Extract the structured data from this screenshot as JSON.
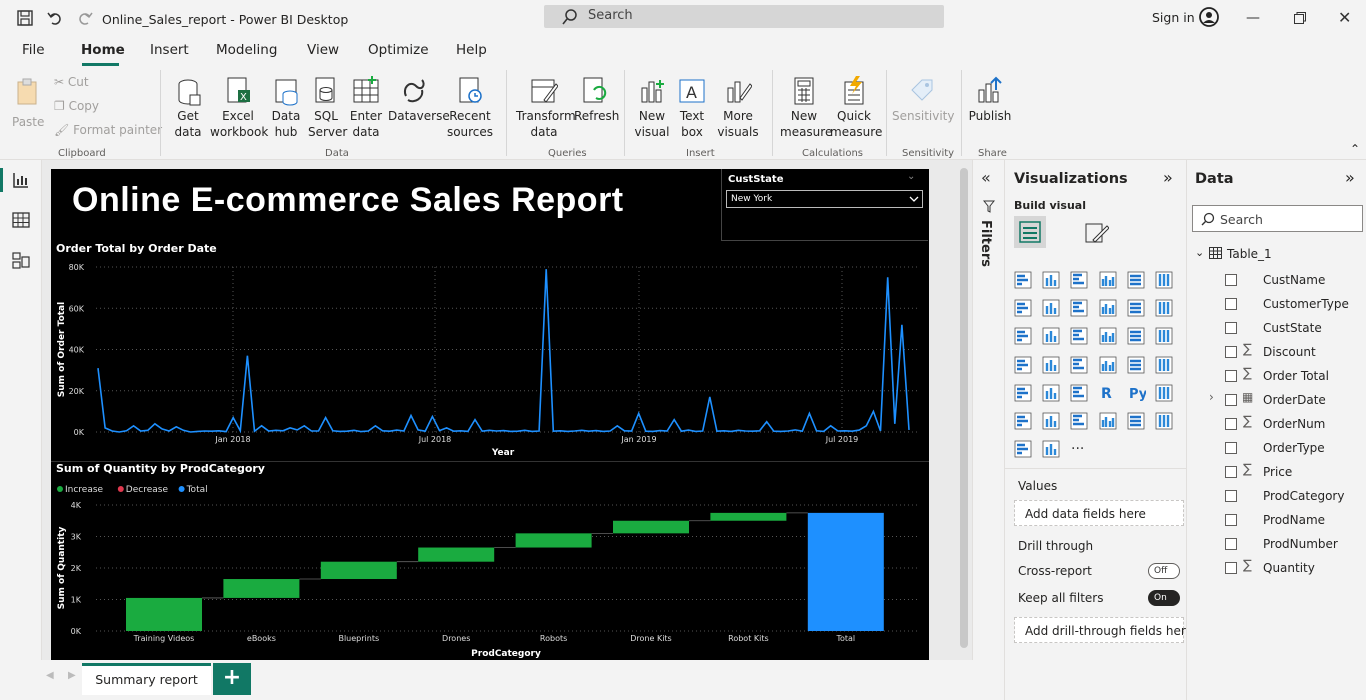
{
  "titlebar": {
    "title": "Online_Sales_report - Power BI Desktop",
    "search": "Search",
    "sign_in": "Sign in"
  },
  "menu": [
    "File",
    "Home",
    "Insert",
    "Modeling",
    "View",
    "Optimize",
    "Help"
  ],
  "ribbon": {
    "clipboard": {
      "paste": "Paste",
      "cut": "Cut",
      "copy": "Copy",
      "format_painter": "Format painter",
      "group": "Clipboard"
    },
    "data": {
      "get_data": "Get data",
      "excel": "Excel workbook",
      "data_hub": "Data hub",
      "sql": "SQL Server",
      "enter_data": "Enter data",
      "dataverse": "Dataverse",
      "recent": "Recent sources",
      "group": "Data"
    },
    "queries": {
      "transform": "Transform data",
      "refresh": "Refresh",
      "group": "Queries"
    },
    "insert": {
      "new_visual": "New visual",
      "text_box": "Text box",
      "more_visuals": "More visuals",
      "group": "Insert"
    },
    "calculations": {
      "new_measure": "New measure",
      "quick_measure": "Quick measure",
      "group": "Calculations"
    },
    "sensitivity": {
      "label": "Sensitivity",
      "group": "Sensitivity"
    },
    "share": {
      "publish": "Publish",
      "group": "Share"
    }
  },
  "report": {
    "title": "Online E-commerce Sales Report",
    "slicer": {
      "label": "CustState",
      "value": "New York"
    }
  },
  "chart_data": [
    {
      "type": "line",
      "title": "Order Total by Order Date",
      "xlabel": "Year",
      "ylabel": "Sum of Order Total",
      "ylim": [
        0,
        80000
      ],
      "yticks": [
        "0K",
        "20K",
        "40K",
        "60K",
        "80K"
      ],
      "xticks": [
        "Jan 2018",
        "Jul 2018",
        "Jan 2019",
        "Jul 2019"
      ],
      "series_color": "#1e90ff",
      "grid": true,
      "series": [
        {
          "values": [
            31000,
            2000,
            500,
            0,
            600,
            3000,
            500,
            800,
            4000,
            1500,
            500,
            2500,
            800,
            0,
            300,
            500,
            400,
            600,
            200,
            7000,
            600,
            37000,
            400,
            3000,
            500,
            800,
            600,
            2000,
            1000,
            3000,
            500,
            500,
            7000,
            600,
            300,
            400,
            800,
            200,
            500,
            3000,
            600,
            400,
            900,
            500,
            8000,
            1000,
            400,
            7500,
            700,
            2000,
            400,
            600,
            300,
            6000,
            400,
            800,
            500,
            700,
            300,
            400,
            800,
            300,
            500,
            79000,
            400,
            600,
            300,
            500,
            800,
            400,
            700,
            300,
            500,
            3000,
            600,
            500,
            9000,
            400,
            300,
            700,
            500,
            6000,
            400,
            900,
            300,
            500,
            17000,
            400,
            600,
            300,
            800,
            500,
            400,
            600,
            5000,
            400,
            300,
            500,
            1000,
            400,
            9000,
            600,
            300,
            3000,
            500,
            600,
            400,
            900,
            3000,
            10000,
            500,
            75000,
            4000,
            52000,
            1000
          ]
        }
      ]
    },
    {
      "type": "waterfall",
      "title": "Sum of Quantity by ProdCategory",
      "xlabel": "ProdCategory",
      "ylabel": "Sum of Quantity",
      "ylim": [
        0,
        4000
      ],
      "yticks": [
        "0K",
        "1K",
        "2K",
        "3K",
        "4K"
      ],
      "legend": [
        {
          "name": "Increase",
          "color": "#1aab40"
        },
        {
          "name": "Decrease",
          "color": "#e0384e"
        },
        {
          "name": "Total",
          "color": "#1e90ff"
        }
      ],
      "categories": [
        "Training Videos",
        "eBooks",
        "Blueprints",
        "Drones",
        "Robots",
        "Drone Kits",
        "Robot Kits",
        "Total"
      ],
      "values": [
        1050,
        600,
        550,
        450,
        450,
        400,
        250,
        3750
      ]
    }
  ],
  "visualizations": {
    "title": "Visualizations",
    "build_visual": "Build visual",
    "values_label": "Values",
    "values_placeholder": "Add data fields here",
    "drill_through": "Drill through",
    "cross_report": "Cross-report",
    "cross_report_state": "Off",
    "keep_filters": "Keep all filters",
    "keep_filters_state": "On",
    "drill_placeholder": "Add drill-through fields here"
  },
  "filters": {
    "label": "Filters"
  },
  "data_pane": {
    "title": "Data",
    "search": "Search",
    "table": "Table_1",
    "fields": [
      {
        "name": "CustName",
        "sigma": false
      },
      {
        "name": "CustomerType",
        "sigma": false
      },
      {
        "name": "CustState",
        "sigma": false
      },
      {
        "name": "Discount",
        "sigma": true
      },
      {
        "name": "Order Total",
        "sigma": true
      },
      {
        "name": "OrderDate",
        "sigma": false,
        "date": true
      },
      {
        "name": "OrderNum",
        "sigma": true
      },
      {
        "name": "OrderType",
        "sigma": false
      },
      {
        "name": "Price",
        "sigma": true
      },
      {
        "name": "ProdCategory",
        "sigma": false
      },
      {
        "name": "ProdName",
        "sigma": false
      },
      {
        "name": "ProdNumber",
        "sigma": false
      },
      {
        "name": "Quantity",
        "sigma": true
      }
    ]
  },
  "tabs": {
    "active": "Summary report",
    "add": "+"
  }
}
